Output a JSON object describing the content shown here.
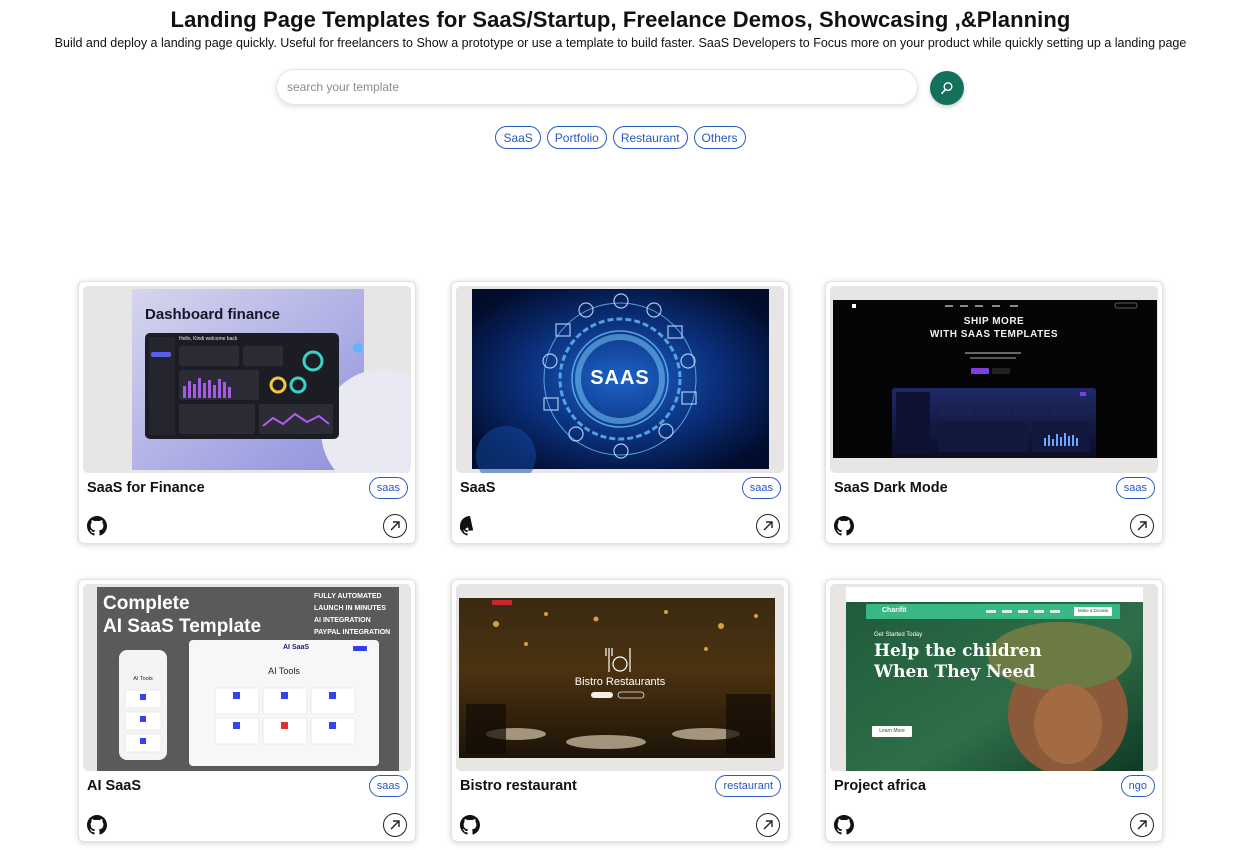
{
  "header": {
    "title": "Landing Page Templates for SaaS/Startup, Freelance Demos, Showcasing ,&Planning",
    "subtitle": "Build and deploy a landing page quickly. Useful for freelancers to Show a prototype or use a template to build faster. SaaS Developers to Focus more on your product while quickly setting up a landing page"
  },
  "search": {
    "placeholder": "search your template",
    "value": ""
  },
  "filters": [
    "SaaS",
    "Portfolio",
    "Restaurant",
    "Others"
  ],
  "cards": [
    {
      "title": "SaaS for Finance",
      "tag": "saas",
      "thumb": {
        "headline": "Dashboard finance",
        "greeting": "Hello, Kindi welcome back"
      }
    },
    {
      "title": "SaaS",
      "tag": "saas",
      "thumb": {
        "headline": "SAAS"
      }
    },
    {
      "title": "SaaS Dark Mode",
      "tag": "saas",
      "thumb": {
        "headline_1": "SHIP MORE",
        "headline_2": "WITH SAAS TEMPLATES"
      }
    },
    {
      "title": "AI SaaS",
      "tag": "saas",
      "thumb": {
        "headline_1": "Complete",
        "headline_2": "AI SaaS Template",
        "features": [
          "FULLY AUTOMATED",
          "LAUNCH IN MINUTES",
          "AI INTEGRATION",
          "PAYPAL INTEGRATION"
        ],
        "brand": "AI SaaS",
        "section": "AI Tools",
        "phone_heading": "AI Tools"
      }
    },
    {
      "title": "Bistro restaurant",
      "tag": "restaurant",
      "thumb": {
        "headline": "Bistro Restaurants"
      }
    },
    {
      "title": "Project africa",
      "tag": "ngo",
      "thumb": {
        "brand": "Charifit",
        "kicker": "Get Started Today",
        "headline_1": "Help the children",
        "headline_2": "When They Need",
        "cta": "Learn More",
        "donate": "Make a Donate"
      }
    }
  ],
  "colors": {
    "accent_green": "#13705a",
    "chip_blue": "#2458c0",
    "charity_green": "#39b886"
  },
  "icons": {
    "search": "search-icon",
    "repo": "github-icon",
    "open": "arrow-up-right-icon"
  }
}
